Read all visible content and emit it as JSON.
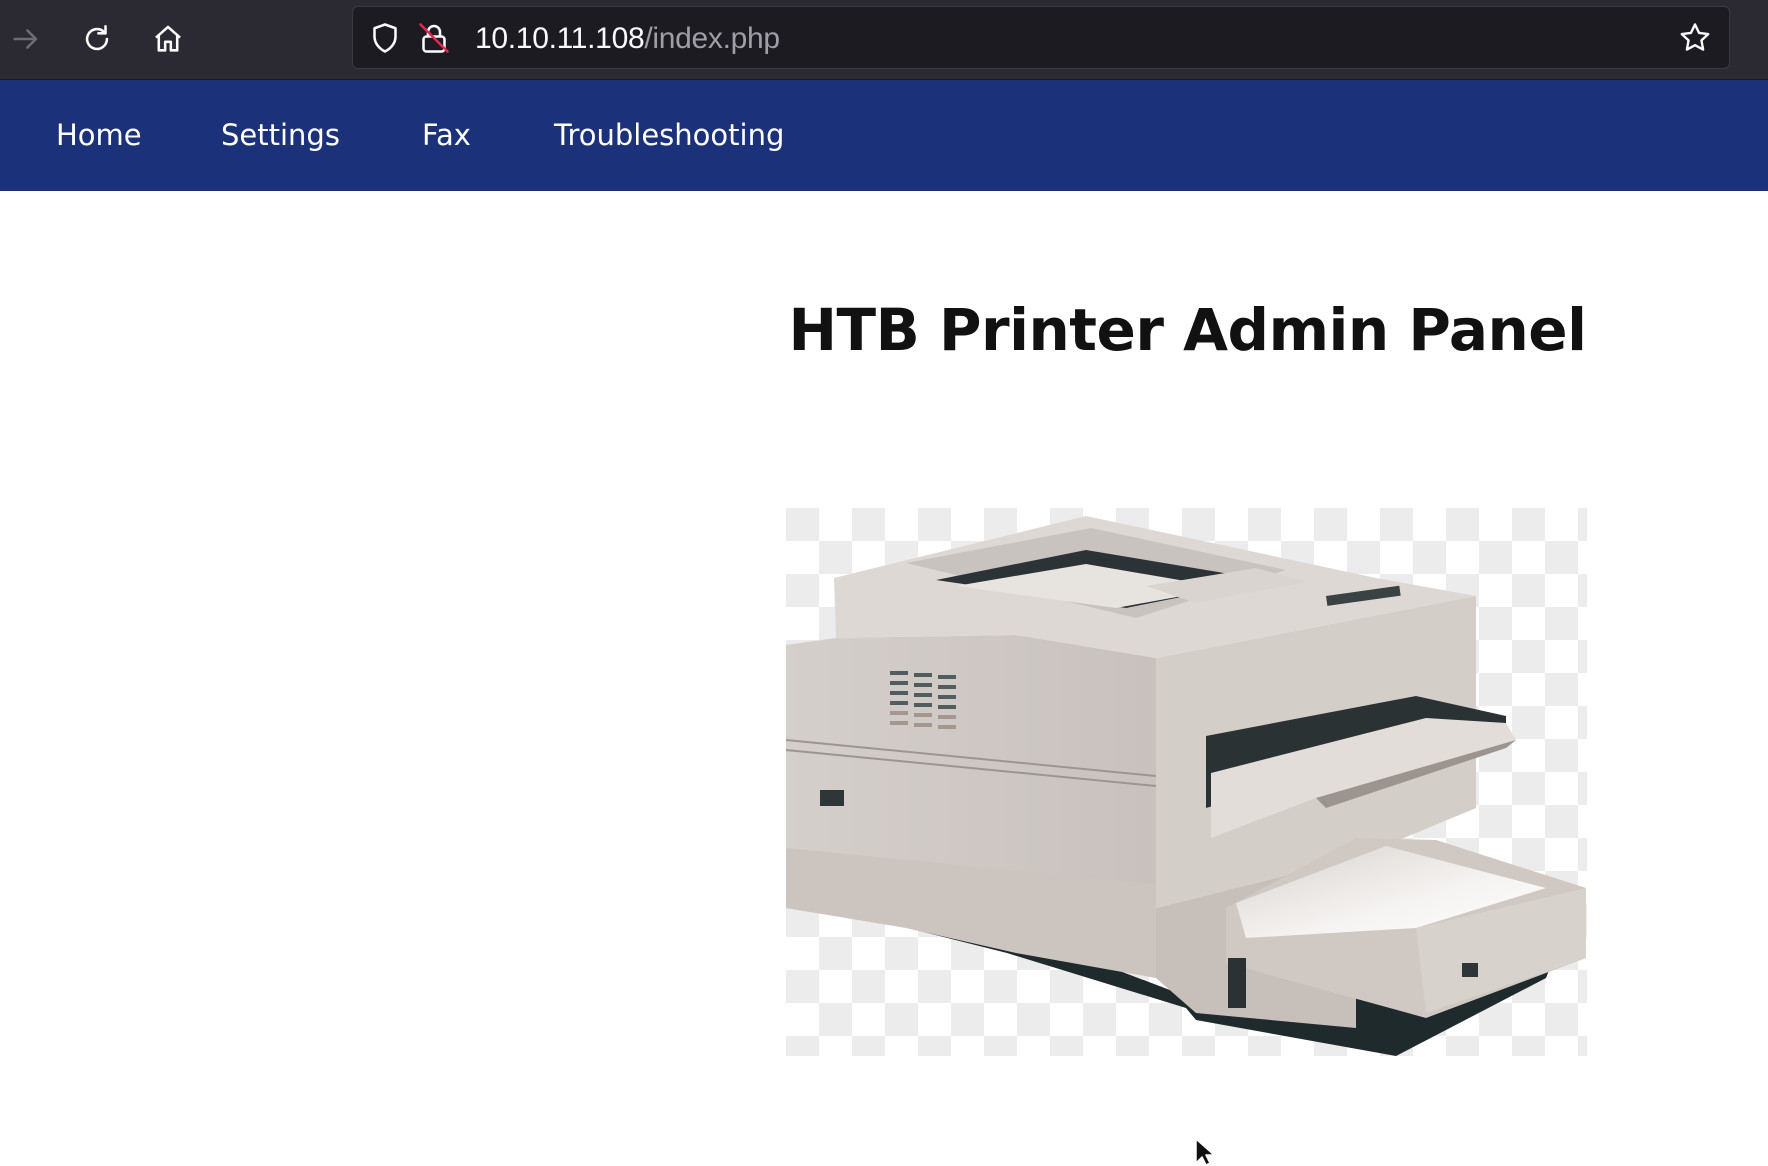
{
  "browser": {
    "url_host": "10.10.11.108",
    "url_path": "/index.php",
    "icons": [
      "forward-arrow-icon",
      "reload-icon",
      "home-icon",
      "shield-icon",
      "insecure-lock-icon",
      "bookmark-star-icon"
    ]
  },
  "nav": {
    "items": [
      {
        "label": "Home"
      },
      {
        "label": "Settings"
      },
      {
        "label": "Fax"
      },
      {
        "label": "Troubleshooting"
      }
    ],
    "background": "#1b327a"
  },
  "main": {
    "title": "HTB Printer Admin Panel",
    "image": "printer-illustration"
  },
  "colors": {
    "chrome_bg": "#2b2a33",
    "urlbar_bg": "#1c1b22",
    "insecure_red": "#e22850"
  }
}
